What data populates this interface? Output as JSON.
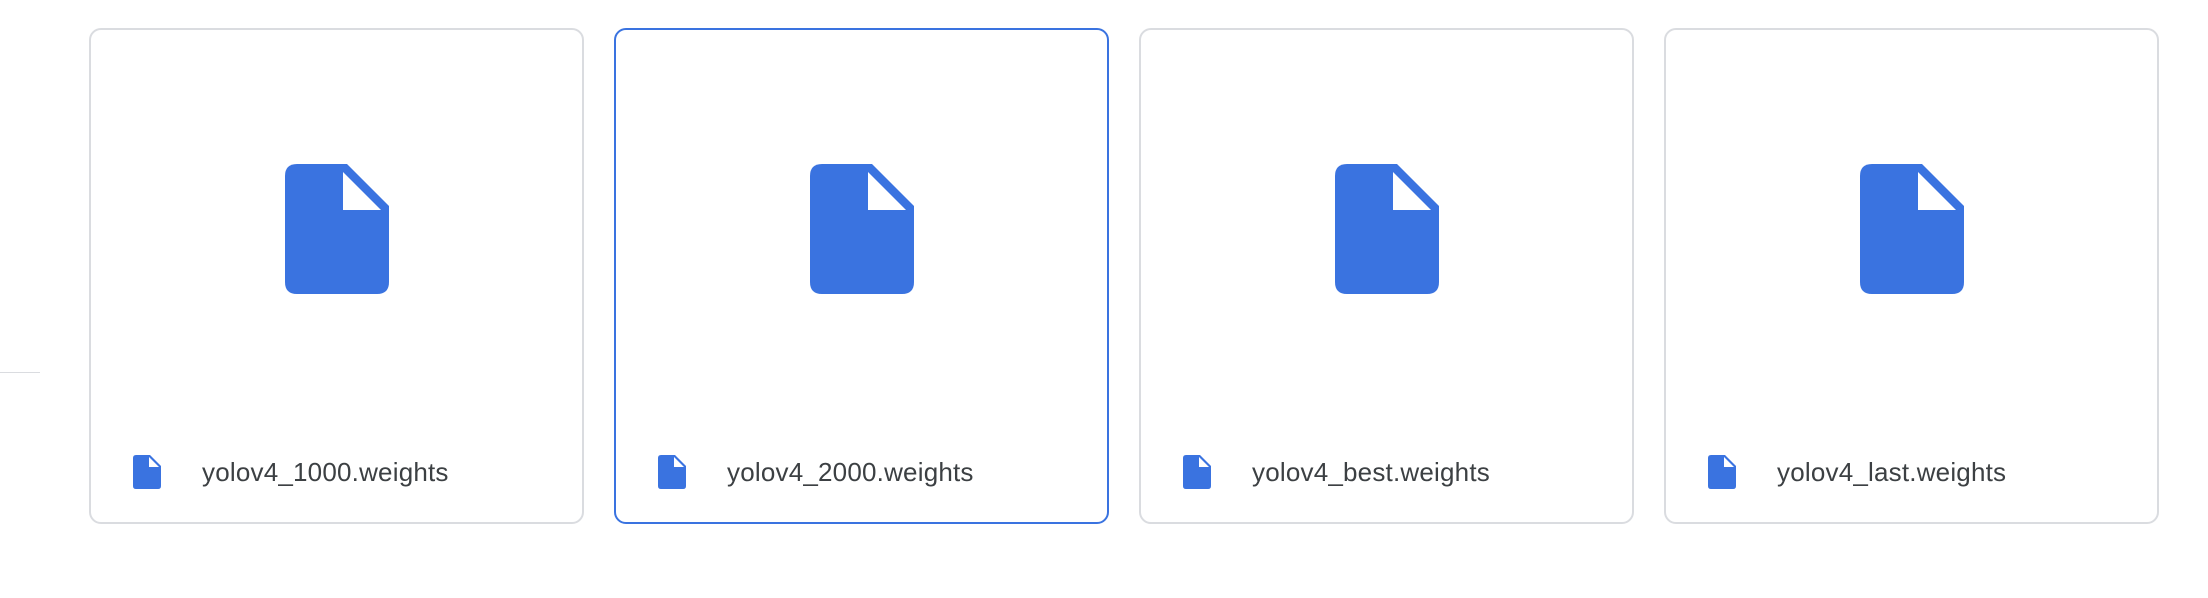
{
  "accent_color": "#3a73e0",
  "file_icon": "document-icon",
  "files": [
    {
      "name": "yolov4_1000.weights",
      "selected": false
    },
    {
      "name": "yolov4_2000.weights",
      "selected": true
    },
    {
      "name": "yolov4_best.weights",
      "selected": false
    },
    {
      "name": "yolov4_last.weights",
      "selected": false
    }
  ]
}
